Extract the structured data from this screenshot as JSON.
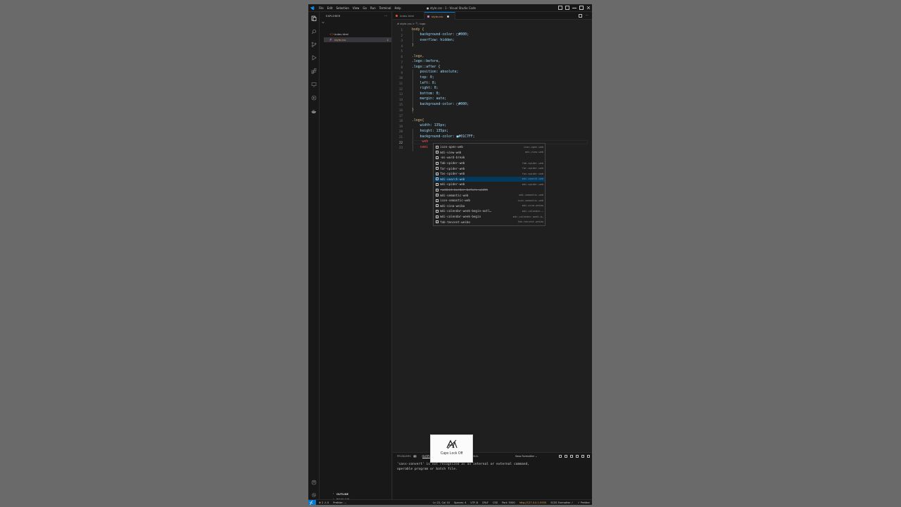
{
  "window": {
    "title": "● style.css - 1 - Visual Studio Code",
    "menu": [
      "File",
      "Edit",
      "Selection",
      "View",
      "Go",
      "Run",
      "Terminal",
      "Help"
    ]
  },
  "sidebar": {
    "header": "EXPLORER",
    "files": [
      {
        "name": "index.html",
        "active": false
      },
      {
        "name": "style.css",
        "active": true,
        "badge": "1"
      }
    ],
    "outline": "OUTLINE",
    "timeline": "TIMELINE"
  },
  "tabs": [
    {
      "label": "index.html",
      "active": false
    },
    {
      "label": "style.css",
      "active": true
    }
  ],
  "breadcrumb": "# style.css > 🏷 logo",
  "editor": {
    "current_line": 22,
    "lines": [
      {
        "n": "1",
        "t": "body {"
      },
      {
        "n": "2",
        "t": "    background-color: □#000;"
      },
      {
        "n": "3",
        "t": "    overflow: hidden;"
      },
      {
        "n": "4",
        "t": "}"
      },
      {
        "n": "5",
        "t": ""
      },
      {
        "n": "6",
        "t": ".logo,"
      },
      {
        "n": "7",
        "t": ".logo::before,"
      },
      {
        "n": "8",
        "t": ".logo::after {"
      },
      {
        "n": "9",
        "t": "    position: absolute;"
      },
      {
        "n": "10",
        "t": "    top: 0;"
      },
      {
        "n": "11",
        "t": "    left: 0;"
      },
      {
        "n": "12",
        "t": "    right: 0;"
      },
      {
        "n": "13",
        "t": "    bottom: 0;"
      },
      {
        "n": "14",
        "t": "    margin: auto;"
      },
      {
        "n": "15",
        "t": "    background-color: □#000;"
      },
      {
        "n": "16",
        "t": "}"
      },
      {
        "n": "17",
        "t": ""
      },
      {
        "n": "18",
        "t": ".logo{"
      },
      {
        "n": "19",
        "t": "    width: 135px;"
      },
      {
        "n": "20",
        "t": "    height: 135px;"
      },
      {
        "n": "21",
        "t": "    background-color: ■#01C7FF;"
      },
      {
        "n": "22",
        "t": "     web"
      },
      {
        "n": "23",
        "t": "    semi"
      }
    ]
  },
  "suggest": [
    {
      "label": "icon-open-web",
      "detail": "icon-open-web",
      "strike": false,
      "selected": false
    },
    {
      "label": "mdi-view-web",
      "detail": "mdi-view-web",
      "strike": false,
      "selected": false
    },
    {
      "label": "-ms-word-break",
      "detail": "",
      "strike": false,
      "selected": false
    },
    {
      "label": "fab-spider-web",
      "detail": "fab-spider-web",
      "strike": false,
      "selected": false
    },
    {
      "label": "far-spider-web",
      "detail": "far-spider-web",
      "strike": false,
      "selected": false
    },
    {
      "label": "fas-spider-web",
      "detail": "fas-spider-web",
      "strike": false,
      "selected": false
    },
    {
      "label": "mdi-search-web",
      "detail": "mdi-search-web",
      "strike": false,
      "selected": true
    },
    {
      "label": "mdi-spider-web",
      "detail": "mdi-spider-web",
      "strike": false,
      "selected": false
    },
    {
      "label": "-webkit-border-before-width",
      "detail": "",
      "strike": true,
      "selected": false
    },
    {
      "label": "mdi-semantic-web",
      "detail": "mdi-semantic-web",
      "strike": false,
      "selected": false
    },
    {
      "label": "icon-semantic-web",
      "detail": "icon-semantic-web",
      "strike": false,
      "selected": false
    },
    {
      "label": "mdi-sina-weibo",
      "detail": "mdi-sina-weibo",
      "strike": false,
      "selected": false
    },
    {
      "label": "mdi-calendar-week-begin-outl…",
      "detail": "mdi-calendar-…",
      "strike": false,
      "selected": false
    },
    {
      "label": "mdi-calendar-week-begin",
      "detail": "mdi-calendar-week-b…",
      "strike": false,
      "selected": false
    },
    {
      "label": "fab-tencent-weibo",
      "detail": "fab-tencent-weibo",
      "strike": false,
      "selected": false
    }
  ],
  "panel": {
    "tabs": [
      "PROBLEMS",
      "OUTPUT",
      "DEBUG CONSOLE",
      "TERMINAL"
    ],
    "problems_count": "2",
    "active_tab": "OUTPUT",
    "channel": "Sass Formatter",
    "output": "'sass-convert' is not recognized as an internal or external command,\noperable program or batch file."
  },
  "status": {
    "left": [
      "⊗ 2  ⚠ 0",
      "Prettier: ..."
    ],
    "right": [
      "Ln 22, Col 10",
      "Spaces: 4",
      "UTF-8",
      "CRLF",
      "CSS",
      "Port: 5500",
      "http://127.0.0.1:5555",
      "SCSS Formatter ✓",
      "✓ Prettier"
    ]
  },
  "capslock": {
    "text": "Caps Lock Off"
  },
  "colors": {
    "accent": "#0078d4",
    "editor_bg": "#1f1f1f",
    "selector": "#d7ba7d",
    "value": "#ce9178",
    "logo_bg_swatch": "#01C7FF"
  }
}
